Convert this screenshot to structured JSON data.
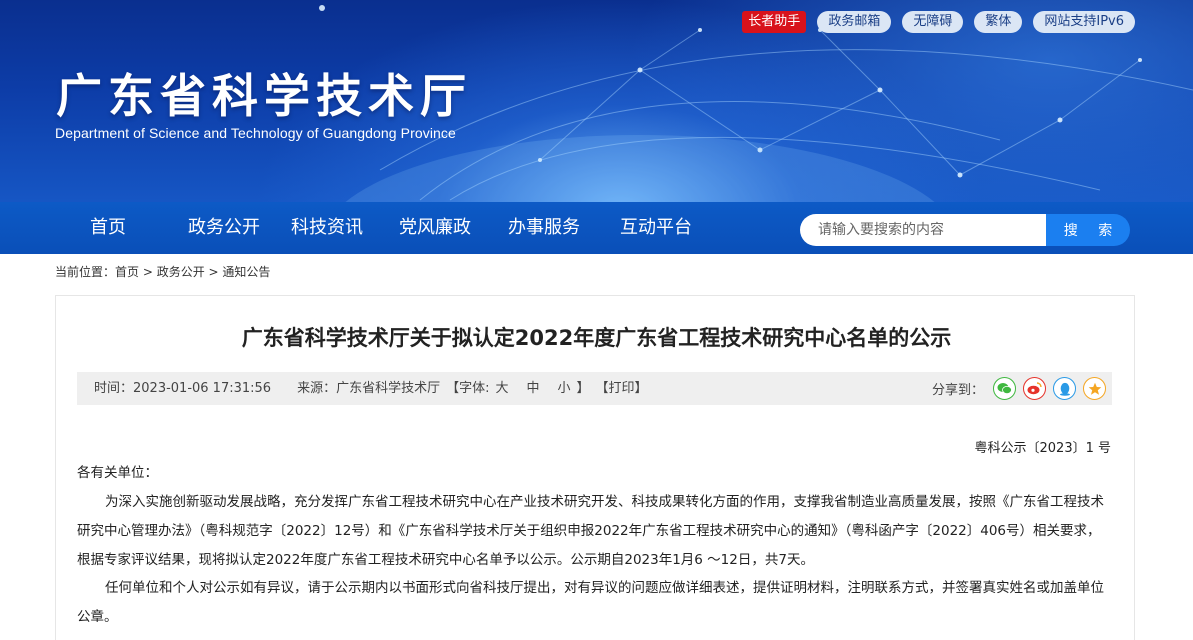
{
  "header": {
    "title": "广东省科学技术厅",
    "subtitle": "Department of Science and Technology of Guangdong Province",
    "top_links": [
      "长者助手",
      "政务邮箱",
      "无障碍",
      "繁体",
      "网站支持IPv6"
    ]
  },
  "nav": {
    "items": [
      "首页",
      "政务公开",
      "科技资讯",
      "党风廉政",
      "办事服务",
      "互动平台"
    ],
    "search_placeholder": "请输入要搜索的内容",
    "search_button": "搜 索"
  },
  "breadcrumb": {
    "prefix": "当前位置：",
    "items": [
      "首页",
      "政务公开",
      "通知公告"
    ],
    "separator": " > "
  },
  "article": {
    "title": "广东省科学技术厅关于拟认定2022年度广东省工程技术研究中心名单的公示",
    "time": "时间：2023-01-06 17:31:56",
    "source": "来源：广东省科学技术厅",
    "font_label": "【字体:",
    "font_large": "大",
    "font_medium": "中",
    "font_small": "小",
    "font_close": "】",
    "print": "【打印】",
    "share_label": "分享到：",
    "share_icons": [
      "wechat-icon",
      "weibo-icon",
      "qq-icon",
      "qzone-icon"
    ],
    "doc_number": "粤科公示〔2023〕1 号",
    "salutation": "各有关单位：",
    "paragraph_1": "为深入实施创新驱动发展战略，充分发挥广东省工程技术研究中心在产业技术研究开发、科技成果转化方面的作用，支撑我省制造业高质量发展，按照《广东省工程技术研究中心管理办法》（粤科规范字〔2022〕12号）和《广东省科学技术厅关于组织申报2022年广东省工程技术研究中心的通知》（粤科函产字〔2022〕406号）相关要求，根据专家评议结果，现将拟认定2022年度广东省工程技术研究中心名单予以公示。公示期自2023年1月6 ～12日，共7天。",
    "paragraph_2": "任何单位和个人对公示如有异议，请于公示期内以书面形式向省科技厅提出，对有异议的问题应做详细表述，提供证明材料，注明联系方式，并签署真实姓名或加盖单位公章。"
  },
  "colors": {
    "nav_bg": "#0a4fb8",
    "search_button": "#1b7ff0",
    "elder_badge": "#d8121b",
    "wechat": "#3fb83f",
    "weibo": "#e6332a",
    "qq": "#2a9ae6",
    "qzone": "#f5a623"
  }
}
